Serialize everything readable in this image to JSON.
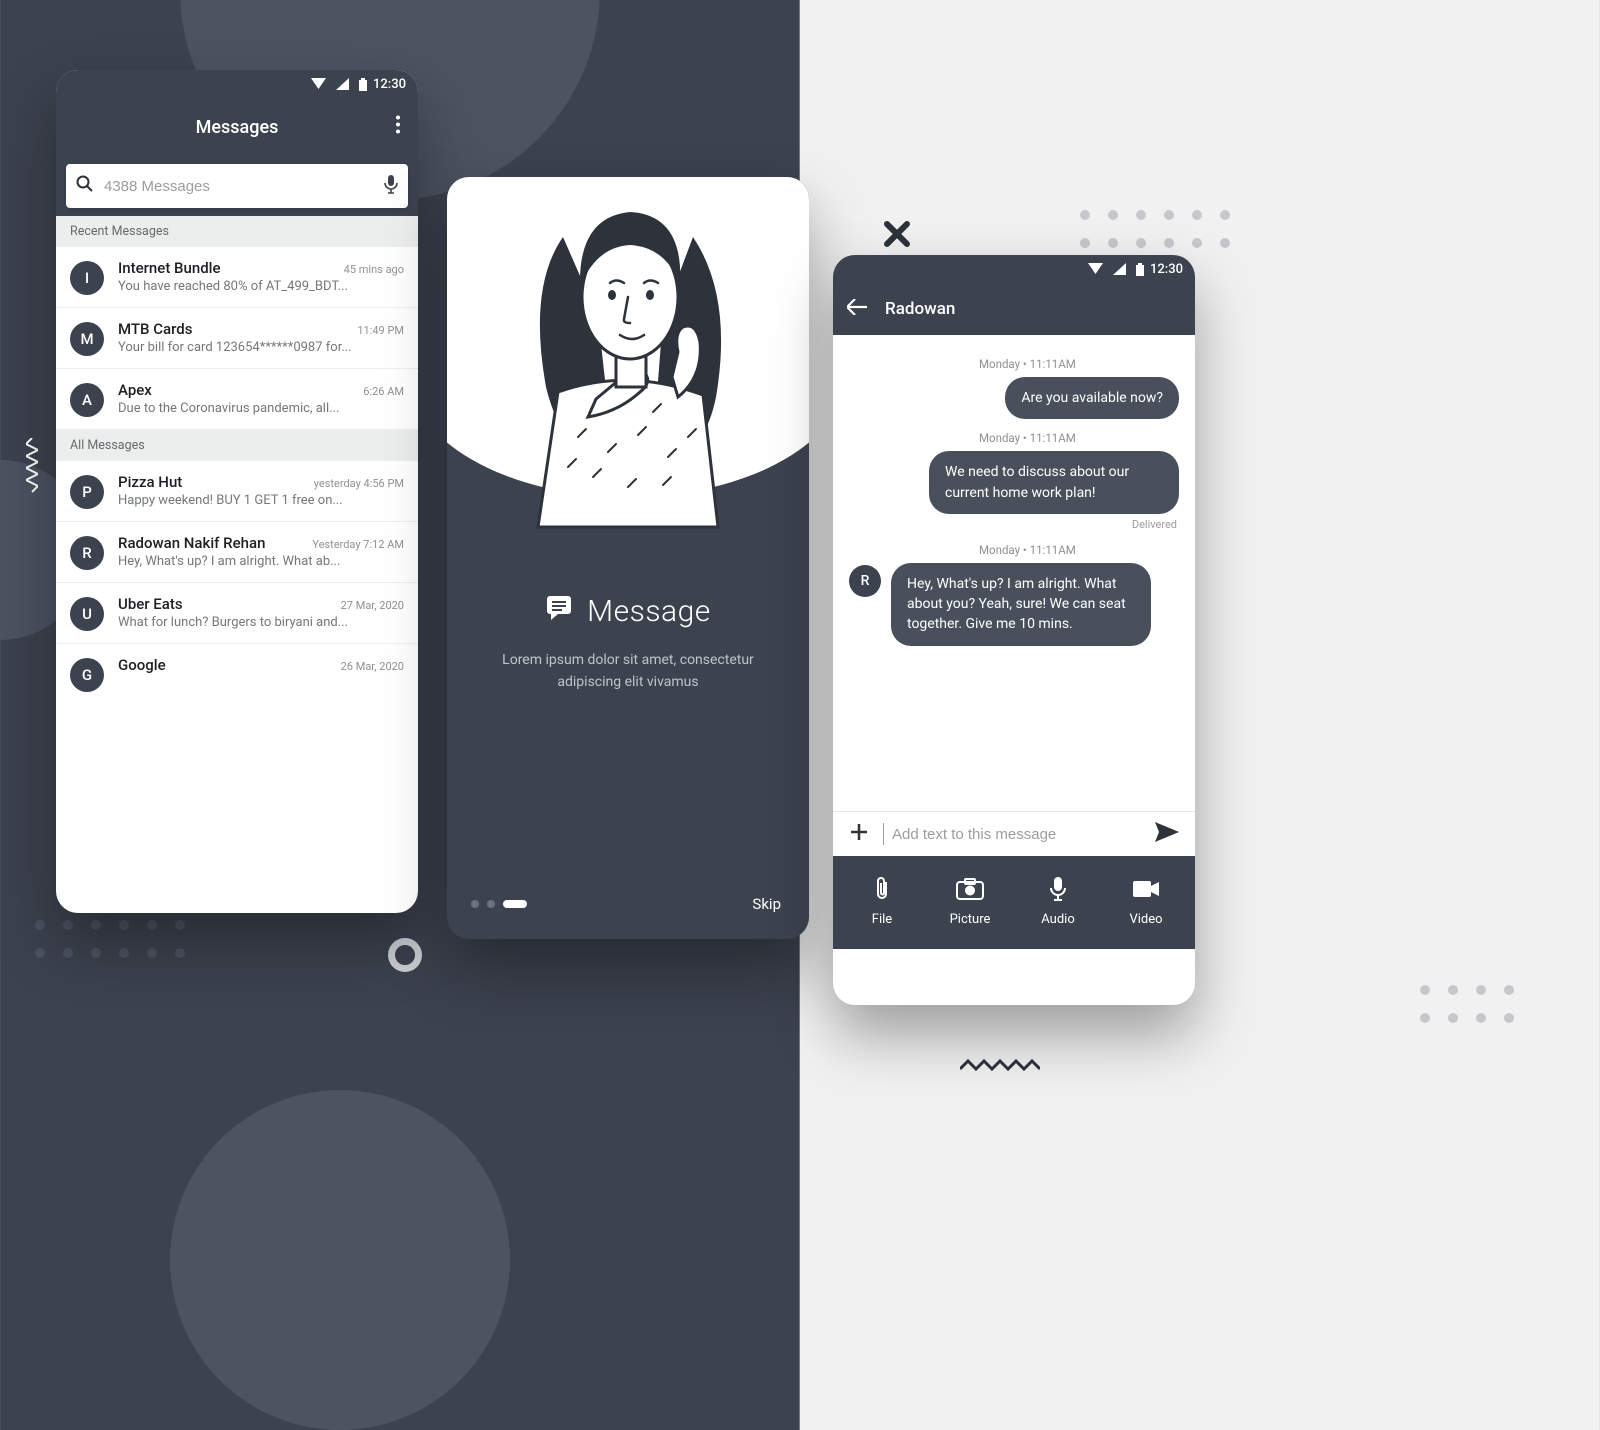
{
  "status": {
    "time": "12:30"
  },
  "list_screen": {
    "title": "Messages",
    "search_placeholder": "4388 Messages",
    "section_recent": "Recent Messages",
    "section_all": "All Messages",
    "recent": [
      {
        "initial": "I",
        "sender": "Internet Bundle",
        "time": "45 mins ago",
        "preview": "You have reached 80% of AT_499_BDT..."
      },
      {
        "initial": "M",
        "sender": "MTB Cards",
        "time": "11:49 PM",
        "preview": "Your bill for card 123654******0987 for..."
      },
      {
        "initial": "A",
        "sender": "Apex",
        "time": "6:26 AM",
        "preview": "Due to the Coronavirus pandemic, all..."
      }
    ],
    "all": [
      {
        "initial": "P",
        "sender": "Pizza Hut",
        "time": "yesterday 4:56 PM",
        "preview": "Happy weekend! BUY 1 GET 1 free on..."
      },
      {
        "initial": "R",
        "sender": "Radowan Nakif Rehan",
        "time": "Yesterday 7:12 AM",
        "preview": "Hey, What's up? I am alright. What ab..."
      },
      {
        "initial": "U",
        "sender": "Uber Eats",
        "time": "27 Mar, 2020",
        "preview": "What for lunch? Burgers to biryani and..."
      },
      {
        "initial": "G",
        "sender": "Google",
        "time": "26 Mar, 2020",
        "preview": ""
      }
    ]
  },
  "onboard": {
    "title": "Message",
    "subtitle": "Lorem ipsum dolor sit amet, consectetur adipiscing elit vivamus",
    "skip": "Skip"
  },
  "chat": {
    "contact": "Radowan",
    "ts1": "Monday  •  11:11AM",
    "msg1": "Are you available now?",
    "ts2": "Monday  •  11:11AM",
    "msg2": "We need to discuss about our current home work plan!",
    "delivered": "Delivered",
    "ts3": "Monday  •  11:11AM",
    "reply_initial": "R",
    "msg3": "Hey, What's up? I am alright. What about you? Yeah, sure! We can seat together. Give me 10 mins.",
    "compose_placeholder": "Add text to this message",
    "attach": {
      "file": "File",
      "picture": "Picture",
      "audio": "Audio",
      "video": "Video"
    }
  }
}
